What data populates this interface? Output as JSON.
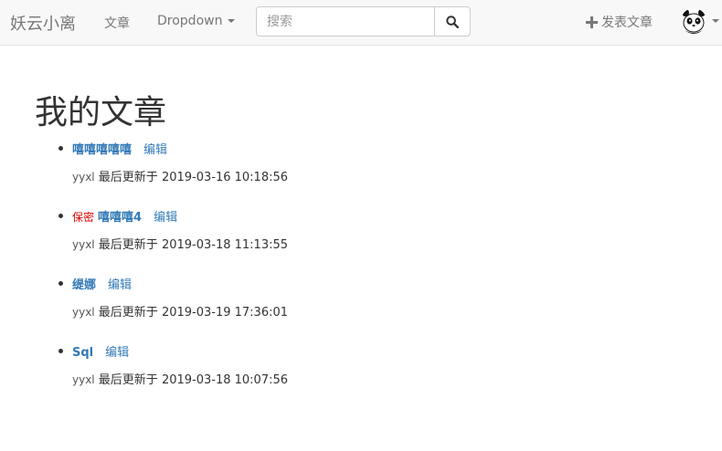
{
  "navbar": {
    "brand": "妖云小离",
    "articles_link": "文章",
    "dropdown_label": "Dropdown",
    "search_placeholder": "搜索",
    "publish_label": "发表文章",
    "icons": {
      "search": "search-icon",
      "publish": "plus-icon",
      "avatar": "panda-avatar",
      "caret": "caret-down-icon"
    }
  },
  "main": {
    "page_title": "我的文章",
    "articles": [
      {
        "secret_badge": "",
        "title": "嘻嘻嘻嘻嘻",
        "edit_label": "编辑",
        "author": "yyxl",
        "updated_prefix": "最后更新于",
        "updated_at": "2019-03-16 10:18:56"
      },
      {
        "secret_badge": "保密",
        "title": "嘻嘻嘻4",
        "edit_label": "编辑",
        "author": "yyxl",
        "updated_prefix": "最后更新于",
        "updated_at": "2019-03-18 11:13:55"
      },
      {
        "secret_badge": "",
        "title": "缇娜",
        "edit_label": "编辑",
        "author": "yyxl",
        "updated_prefix": "最后更新于",
        "updated_at": "2019-03-19 17:36:01"
      },
      {
        "secret_badge": "",
        "title": "Sql",
        "edit_label": "编辑",
        "author": "yyxl",
        "updated_prefix": "最后更新于",
        "updated_at": "2019-03-18 10:07:56"
      }
    ]
  },
  "colors": {
    "link": "#337ab7",
    "secret": "#e00000",
    "navbar_bg": "#f8f8f8",
    "navbar_text": "#777777"
  }
}
